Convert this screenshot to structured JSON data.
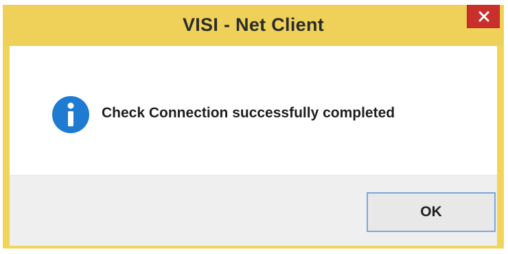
{
  "window": {
    "title": "VISI - Net Client",
    "close_symbol": "×",
    "close_icon": "close-icon"
  },
  "dialog": {
    "icon": "info-icon",
    "icon_glyph": "i",
    "message": "Check Connection successfully completed"
  },
  "footer": {
    "ok_label": "OK"
  },
  "colors": {
    "titlebar": "#efd15a",
    "close_button": "#c9302c",
    "info_icon": "#1f7ad1",
    "footer": "#efefef",
    "ok_border": "#7aa7d6"
  }
}
